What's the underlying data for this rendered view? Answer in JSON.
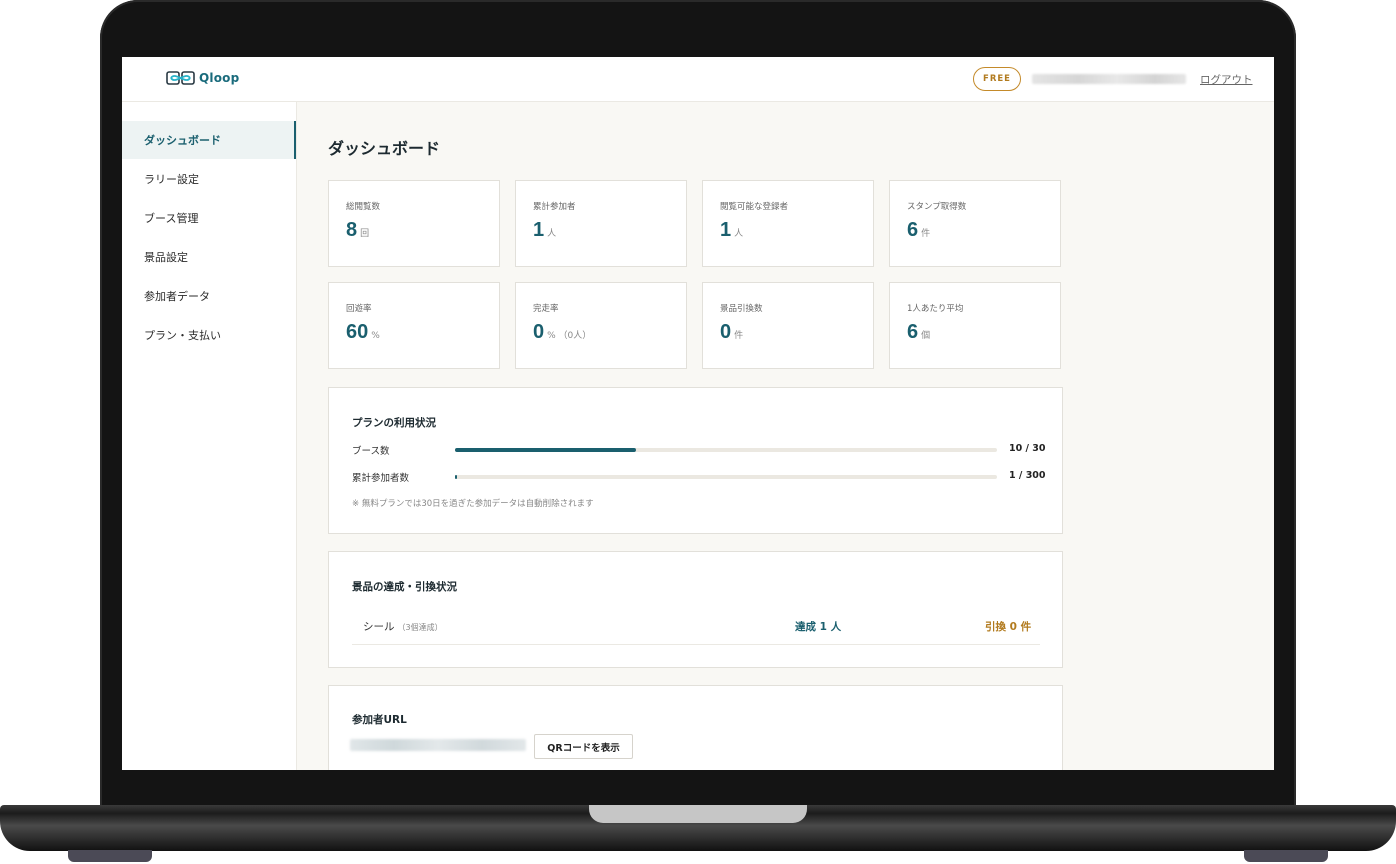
{
  "app": {
    "logo_text": "Qloop",
    "plan_badge": "FREE",
    "logout_label": "ログアウト"
  },
  "sidebar": {
    "items": [
      {
        "label": "ダッシュボード",
        "active": true
      },
      {
        "label": "ラリー設定"
      },
      {
        "label": "ブース管理"
      },
      {
        "label": "景品設定"
      },
      {
        "label": "参加者データ"
      },
      {
        "label": "プラン・支払い"
      }
    ]
  },
  "main": {
    "title": "ダッシュボード",
    "stats": [
      {
        "label": "総閲覧数",
        "value": "8",
        "unit": "回"
      },
      {
        "label": "累計参加者",
        "value": "1",
        "unit": "人"
      },
      {
        "label": "閲覧可能な登録者",
        "value": "1",
        "unit": "人"
      },
      {
        "label": "スタンプ取得数",
        "value": "6",
        "unit": "件"
      },
      {
        "label": "回遊率",
        "value": "60",
        "unit": "%"
      },
      {
        "label": "完走率",
        "value": "0",
        "unit": "% （0人）"
      },
      {
        "label": "景品引換数",
        "value": "0",
        "unit": "件"
      },
      {
        "label": "1人あたり平均",
        "value": "6",
        "unit": "個"
      }
    ],
    "plan_usage": {
      "title": "プランの利用状況",
      "rows": [
        {
          "label": "ブース数",
          "count": "10 / 30",
          "fraction": 0.3333
        },
        {
          "label": "累計参加者数",
          "count": "1 / 300",
          "fraction": 0.0033
        }
      ],
      "note": "※ 無料プランでは30日を過ぎた参加データは自動削除されます"
    },
    "prizes": {
      "title": "景品の達成・引換状況",
      "rows": [
        {
          "name": "シール",
          "condition": "（3個達成）",
          "achieved": "達成 1 人",
          "redeemed": "引換 0 件"
        }
      ]
    },
    "participant_url": {
      "title": "参加者URL",
      "qr_button_label": "QRコードを表示"
    }
  },
  "colors": {
    "accent": "#1a5f6e",
    "gold": "#b27b1f",
    "background": "#f9f8f4"
  }
}
